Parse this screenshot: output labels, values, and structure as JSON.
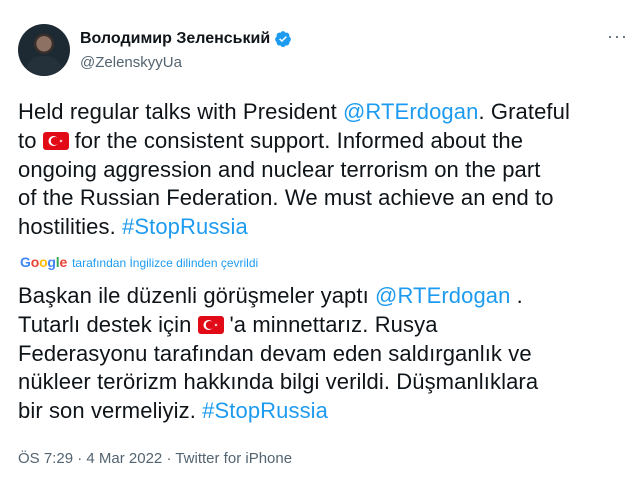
{
  "author": {
    "display_name": "Володимир Зеленський",
    "handle": "@ZelenskyyUa"
  },
  "menu": {
    "more_label": "···"
  },
  "original": {
    "line1_pre": "Held regular talks with President ",
    "line1_mention": "@RTErdogan",
    "line1_post": ". Grateful",
    "line2_pre": "to",
    "line2_post": "for the consistent support. Informed about the",
    "line3": "ongoing aggression and nuclear terrorism on the part",
    "line4": "of the Russian Federation. We must achieve an end to",
    "line5_pre": "hostilities.  ",
    "line5_hashtag": "#StopRussia"
  },
  "translation_note": {
    "logo": [
      "G",
      "o",
      "o",
      "g",
      "l",
      "e"
    ],
    "text": "tarafından İngilizce dilinden çevrildi"
  },
  "translated": {
    "line1_pre": "Başkan ile düzenli görüşmeler yaptı ",
    "line1_mention": "@RTErdogan",
    "line1_post": " .",
    "line2_pre": "Tutarlı destek için",
    "line2_post": "'a minnettarız. Rusya",
    "line3": "Federasyonu tarafından devam eden saldırganlık ve",
    "line4": "nükleer terörizm hakkında bilgi verildi. Düşmanlıklara",
    "line5_pre": "bir son vermeliyiz. ",
    "line5_hashtag": "#StopRussia"
  },
  "meta": {
    "time": "ÖS 7:29",
    "sep1": " · ",
    "date": "4 Mar 2022",
    "sep2": " · ",
    "source": "Twitter for iPhone"
  },
  "colors": {
    "link": "#1d9bf0",
    "text": "#0f1419",
    "muted": "#536471",
    "flag_red": "#e30a17"
  },
  "icons": {
    "verified": "verified-badge-icon",
    "flag": "turkey-flag-icon"
  }
}
